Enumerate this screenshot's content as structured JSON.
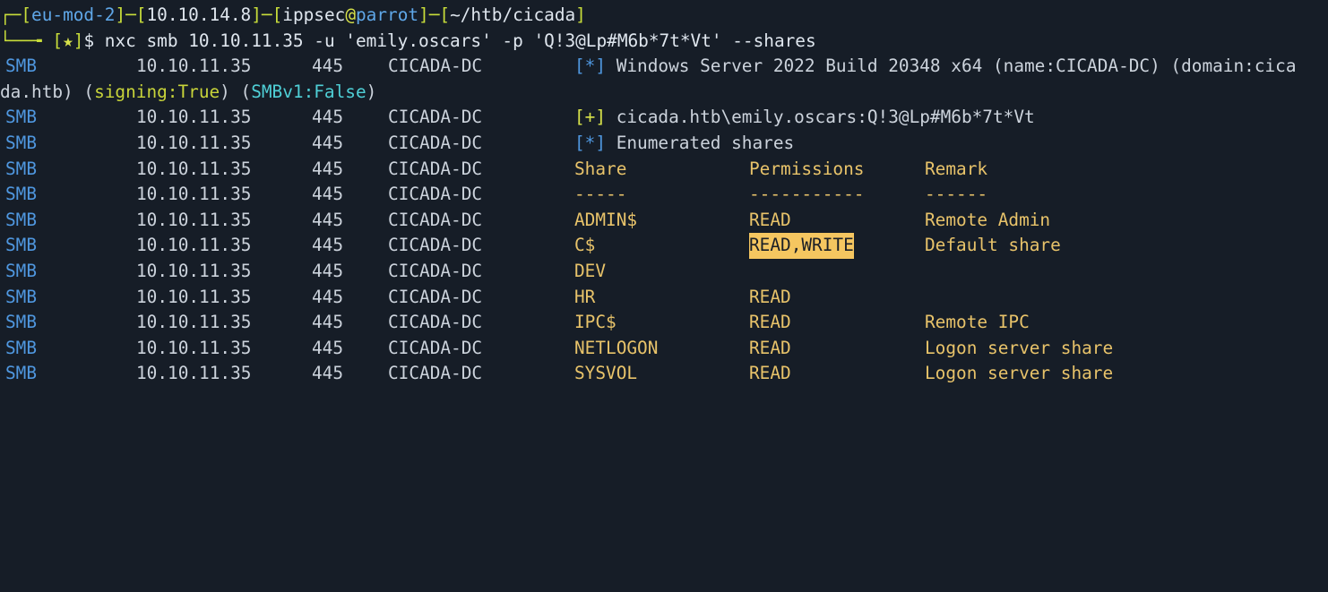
{
  "prompt": {
    "frame_top": "┌─",
    "frame_bottom": "└──╼",
    "host_seg": "eu-mod-2",
    "ip_seg": "10.10.14.8",
    "user": "ippsec",
    "at": "@",
    "machine": "parrot",
    "dir": "~/htb/cicada",
    "status": "★",
    "dollar": "$",
    "command": " nxc smb 10.10.11.35 -u 'emily.oscars' -p 'Q!3@Lp#M6b*7t*Vt' --shares"
  },
  "output": {
    "proto": "SMB",
    "ip": "10.10.11.35",
    "port": "445",
    "host": "CICADA-DC",
    "info_marker": "[*]",
    "plus_marker": "[+]",
    "banner_a": " Windows Server 2022 Build 20348 x64 (name:CICADA-DC) (domain:cica",
    "banner_b": "da.htb) (",
    "signing_label": "signing:True",
    "mid": ") (",
    "smbv1_label": "SMBv1:False",
    "end": ")",
    "auth": " cicada.htb\\emily.oscars:Q!3@Lp#M6b*7t*Vt",
    "enum": " Enumerated shares"
  },
  "table": {
    "headers": [
      "Share",
      "Permissions",
      "Remark"
    ],
    "dividers": [
      "-----",
      "-----------",
      "------"
    ],
    "rows": [
      {
        "share": "ADMIN$",
        "perm": "READ",
        "remark": "Remote Admin"
      },
      {
        "share": "C$",
        "perm": "READ,WRITE",
        "remark": "Default share"
      },
      {
        "share": "DEV",
        "perm": "",
        "remark": ""
      },
      {
        "share": "HR",
        "perm": "READ",
        "remark": ""
      },
      {
        "share": "IPC$",
        "perm": "READ",
        "remark": "Remote IPC"
      },
      {
        "share": "NETLOGON",
        "perm": "READ",
        "remark": "Logon server share"
      },
      {
        "share": "SYSVOL",
        "perm": "READ",
        "remark": "Logon server share"
      }
    ]
  },
  "colors": {
    "background": "#161d27",
    "foreground": "#ccd3dc",
    "prompt_frame": "#c8dd3a",
    "smb_blue": "#4f97df",
    "table_yellow": "#e8c36a",
    "highlight": "#f5c660"
  }
}
